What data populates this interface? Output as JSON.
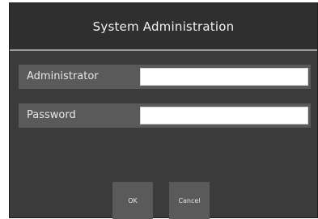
{
  "dialog": {
    "title": "System Administration"
  },
  "fields": {
    "administrator": {
      "label": "Administrator",
      "value": ""
    },
    "password": {
      "label": "Password",
      "value": ""
    }
  },
  "buttons": {
    "ok_label": "OK",
    "cancel_label": "Cancel"
  }
}
